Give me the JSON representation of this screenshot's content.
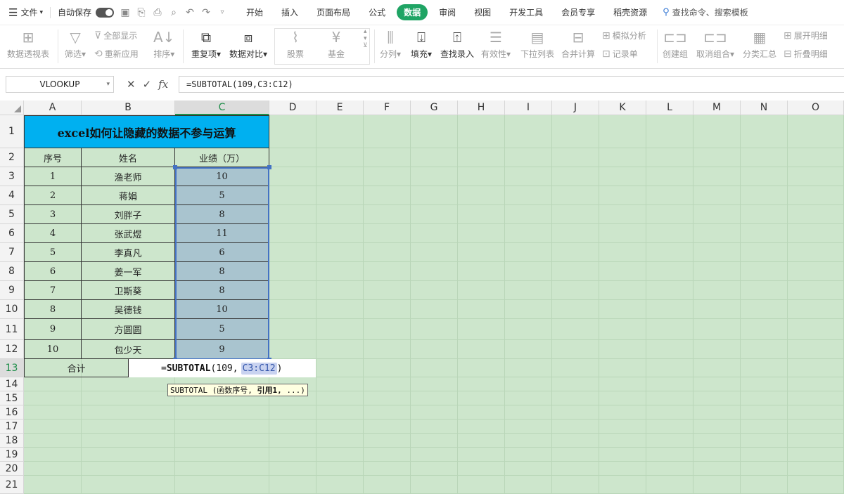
{
  "menubar": {
    "file_label": "文件",
    "autosave_label": "自动保存",
    "tabs": [
      "开始",
      "插入",
      "页面布局",
      "公式",
      "数据",
      "审阅",
      "视图",
      "开发工具",
      "会员专享",
      "稻壳资源"
    ],
    "active_tab": "数据",
    "search_label": "查找命令、搜索模板"
  },
  "ribbon": {
    "pivot": "数据透视表",
    "filter": "筛选",
    "show_all": "全部显示",
    "reapply": "重新应用",
    "sort": "排序",
    "duplicates": "重复项",
    "compare": "数据对比",
    "stocks": "股票",
    "funds": "基金",
    "split": "分列",
    "fill": "填充",
    "lookup_entry": "查找录入",
    "validity": "有效性",
    "dropdown_list": "下拉列表",
    "consolidate": "合并计算",
    "what_if": "模拟分析",
    "record_form": "记录单",
    "create_group": "创建组",
    "ungroup": "取消组合",
    "subtotal": "分类汇总",
    "expand_detail": "展开明细",
    "collapse_detail": "折叠明细"
  },
  "formula_bar": {
    "name_box": "VLOOKUP",
    "formula": "=SUBTOTAL(109,C3:C12)"
  },
  "columns": [
    "A",
    "B",
    "C",
    "D",
    "E",
    "F",
    "G",
    "H",
    "I",
    "J",
    "K",
    "L",
    "M",
    "N",
    "O"
  ],
  "rows": [
    "1",
    "2",
    "3",
    "4",
    "5",
    "6",
    "7",
    "8",
    "9",
    "10",
    "11",
    "12",
    "13",
    "14",
    "15",
    "16",
    "17",
    "18",
    "19",
    "20",
    "21"
  ],
  "sheet": {
    "title": "excel如何让隐藏的数据不参与运算",
    "headers": [
      "序号",
      "姓名",
      "业绩（万）"
    ],
    "records": [
      [
        "1",
        "渔老师",
        "10"
      ],
      [
        "2",
        "蒋娟",
        "5"
      ],
      [
        "3",
        "刘胖子",
        "8"
      ],
      [
        "4",
        "张武煜",
        "11"
      ],
      [
        "5",
        "李真凡",
        "6"
      ],
      [
        "6",
        "姜一军",
        "8"
      ],
      [
        "7",
        "卫斯葵",
        "8"
      ],
      [
        "8",
        "吴德钱",
        "10"
      ],
      [
        "9",
        "方圆圆",
        "5"
      ],
      [
        "10",
        "包少天",
        "9"
      ]
    ],
    "total_label": "合计",
    "edit_prefix": "=",
    "edit_func": "SUBTOTAL",
    "edit_args_open": "(109,",
    "edit_ref": "C3:C12",
    "edit_close": ")",
    "tooltip_func": "SUBTOTAL",
    "tooltip_arg1": "(函数序号,",
    "tooltip_arg2": "引用1,",
    "tooltip_rest": "...)"
  }
}
